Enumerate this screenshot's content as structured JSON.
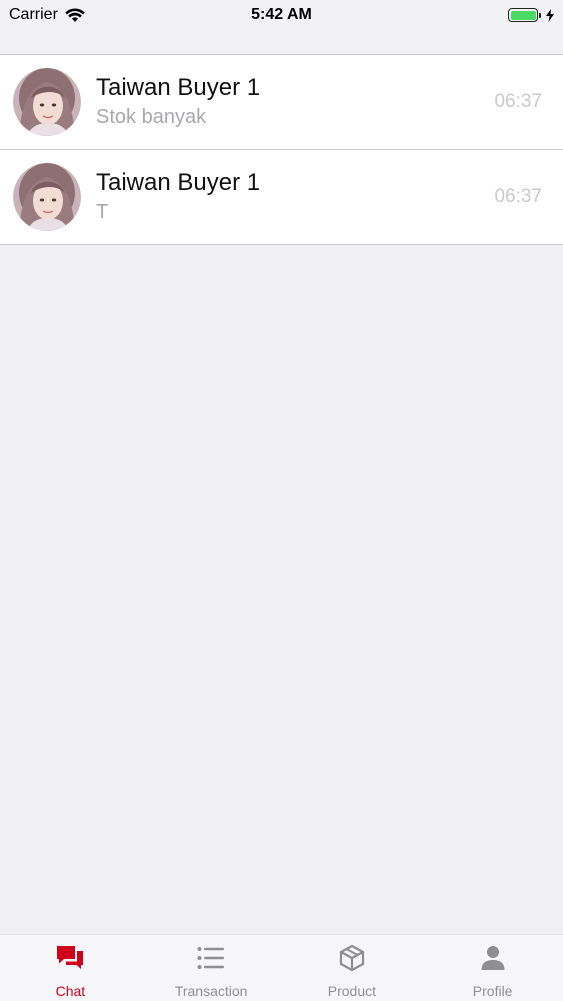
{
  "status_bar": {
    "carrier": "Carrier",
    "time": "5:42 AM",
    "battery_level": 1.0
  },
  "chats": [
    {
      "name": "Taiwan Buyer 1",
      "preview": "Stok banyak",
      "time": "06:37",
      "avatar_icon": "user-avatar"
    },
    {
      "name": "Taiwan Buyer 1",
      "preview": "T",
      "time": "06:37",
      "avatar_icon": "user-avatar"
    }
  ],
  "tab_bar": {
    "active_color": "#d0021b",
    "inactive_color": "#8e8e93",
    "items": [
      {
        "label": "Chat",
        "icon": "chat-bubbles-icon",
        "active": true
      },
      {
        "label": "Transaction",
        "icon": "list-icon",
        "active": false
      },
      {
        "label": "Product",
        "icon": "box-icon",
        "active": false
      },
      {
        "label": "Profile",
        "icon": "person-icon",
        "active": false
      }
    ]
  }
}
